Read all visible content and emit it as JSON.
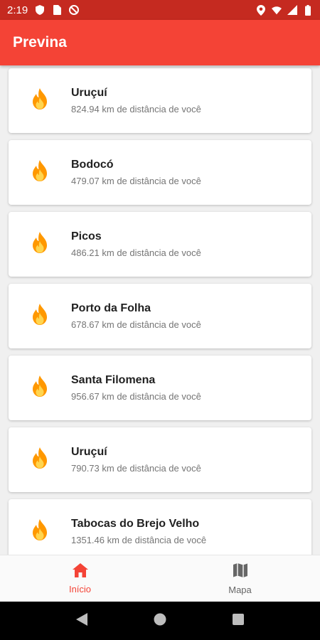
{
  "status_bar": {
    "time": "2:19",
    "icons_left": [
      "shield-icon",
      "sim-card-icon",
      "no-disturb-icon"
    ],
    "icons_right": [
      "location-icon",
      "wifi-icon",
      "signal-icon",
      "battery-icon"
    ]
  },
  "app_bar": {
    "title": "Previna"
  },
  "colors": {
    "primary": "#f44336",
    "status_bar": "#c52a20",
    "fire_outer": "#ff9800",
    "fire_inner": "#ffd54f"
  },
  "fire_list": [
    {
      "city": "Uruçuí",
      "distance": "824.94 km de distância de você"
    },
    {
      "city": "Bodocó",
      "distance": "479.07 km de distância de você"
    },
    {
      "city": "Picos",
      "distance": "486.21 km de distância de você"
    },
    {
      "city": "Porto da Folha",
      "distance": "678.67 km de distância de você"
    },
    {
      "city": "Santa Filomena",
      "distance": "956.67 km de distância de você"
    },
    {
      "city": "Uruçuí",
      "distance": "790.73 km de distância de você"
    },
    {
      "city": "Tabocas do Brejo Velho",
      "distance": "1351.46 km de distância de você"
    }
  ],
  "bottom_nav": {
    "items": [
      {
        "label": "Início",
        "icon": "home-icon",
        "active": true
      },
      {
        "label": "Mapa",
        "icon": "map-icon",
        "active": false
      }
    ]
  },
  "system_nav": {
    "icons": [
      "back-icon",
      "home-circle-icon",
      "recents-icon"
    ]
  }
}
